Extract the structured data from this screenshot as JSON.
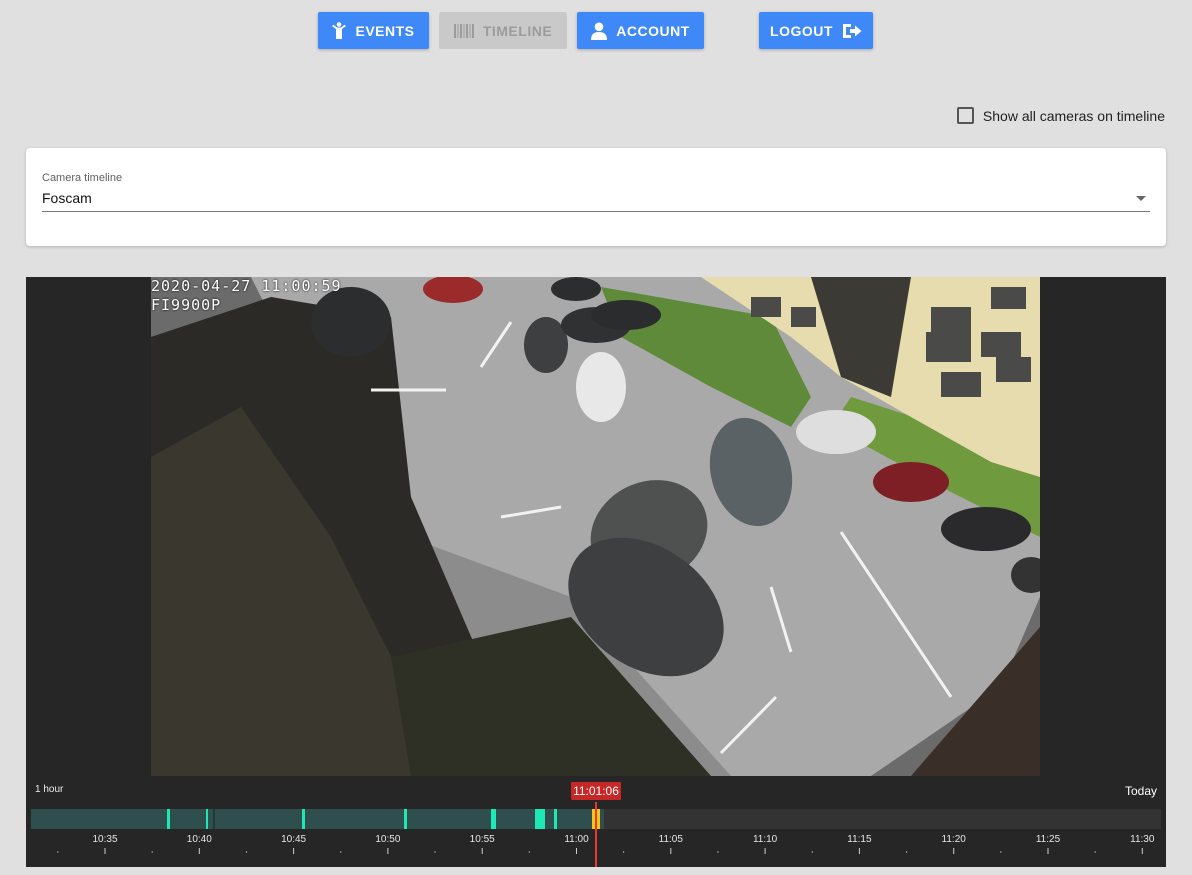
{
  "nav": {
    "events_label": "EVENTS",
    "timeline_label": "TIMELINE",
    "account_label": "ACCOUNT",
    "logout_label": "LOGOUT"
  },
  "options": {
    "show_all_label": "Show all cameras on timeline",
    "show_all_checked": false
  },
  "camera_select": {
    "label": "Camera timeline",
    "value": "Foscam"
  },
  "video": {
    "timestamp": "2020-04-27 11:00:59",
    "camera_model": "FI9900P"
  },
  "timeline": {
    "range_label": "1 hour",
    "today_label": "Today",
    "cursor_time": "11:01:06",
    "tick_labels": [
      "10:35",
      "10:40",
      "10:45",
      "10:50",
      "10:55",
      "11:00",
      "11:05",
      "11:10",
      "11:15",
      "11:20",
      "11:25",
      "11:30"
    ],
    "colors": {
      "recording": "#2f4f4f",
      "motion": "#1de9b6",
      "current": "#f5c518",
      "cursor": "#e53935",
      "empty": "#333333"
    }
  }
}
